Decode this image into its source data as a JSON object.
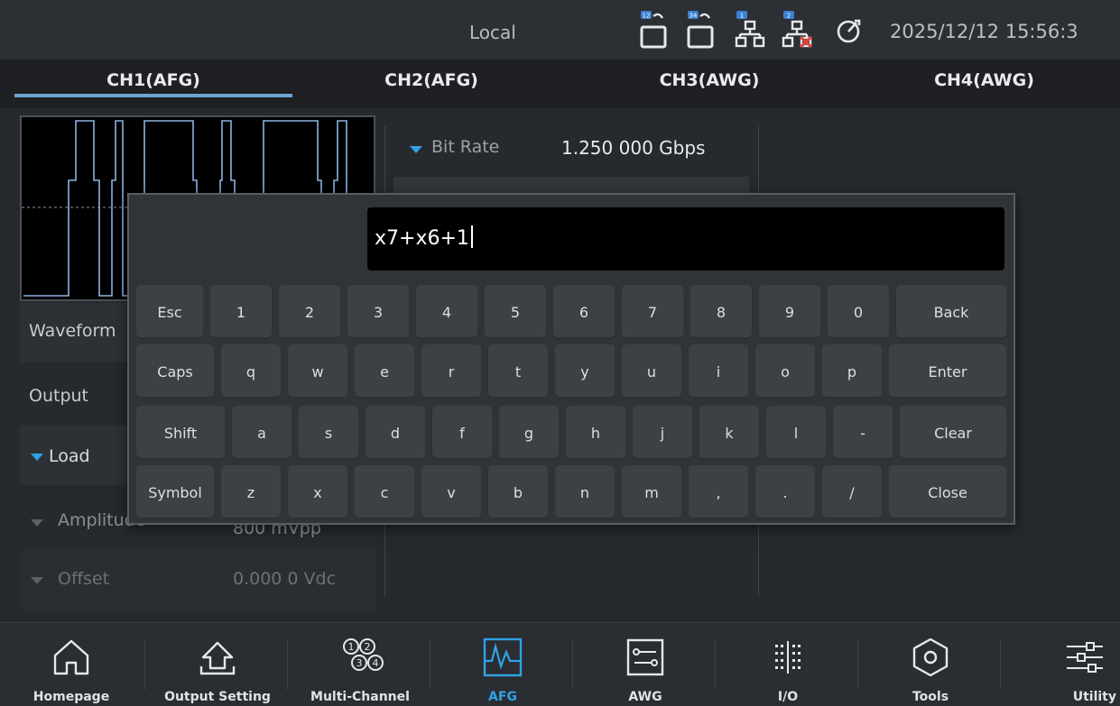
{
  "status_bar": {
    "title": "Local",
    "datetime": "2025/12/12 15:56:3",
    "icons": [
      "lock-12-icon",
      "lock-34-icon",
      "network-1-icon",
      "network-2-disconnected-icon",
      "timer-icon"
    ],
    "icon_badges": [
      "12",
      "34",
      "1",
      "2"
    ]
  },
  "tabs": [
    {
      "label": "CH1(AFG)",
      "active": true
    },
    {
      "label": "CH2(AFG)",
      "active": false
    },
    {
      "label": "CH3(AWG)",
      "active": false
    },
    {
      "label": "CH4(AWG)",
      "active": false
    }
  ],
  "left_panel": {
    "waveform_label": "Waveform",
    "output_label": "Output",
    "load_label": "Load",
    "amplitude_label": "Amplitude",
    "amplitude_value": "800 mVpp",
    "offset_label": "Offset",
    "offset_value": "0.000 0 Vdc"
  },
  "right_panel": {
    "bit_rate_label": "Bit Rate",
    "bit_rate_value": "1.250 000 Gbps"
  },
  "keyboard": {
    "input_value": "x7+x6+1",
    "rows": [
      [
        "Esc",
        "1",
        "2",
        "3",
        "4",
        "5",
        "6",
        "7",
        "8",
        "9",
        "0",
        "Back"
      ],
      [
        "Caps",
        "q",
        "w",
        "e",
        "r",
        "t",
        "y",
        "u",
        "i",
        "o",
        "p",
        "Enter"
      ],
      [
        "Shift",
        "a",
        "s",
        "d",
        "f",
        "g",
        "h",
        "j",
        "k",
        "l",
        "-",
        "Clear"
      ],
      [
        "Symbol",
        "z",
        "x",
        "c",
        "v",
        "b",
        "n",
        "m",
        ",",
        ".",
        "/",
        "Close"
      ]
    ]
  },
  "bottom_nav": [
    {
      "label": "Homepage",
      "icon": "home-icon",
      "active": false
    },
    {
      "label": "Output Setting",
      "icon": "output-setting-icon",
      "active": false
    },
    {
      "label": "Multi-Channel",
      "icon": "multi-channel-icon",
      "active": false
    },
    {
      "label": "AFG",
      "icon": "afg-waveform-icon",
      "active": true
    },
    {
      "label": "AWG",
      "icon": "awg-icon",
      "active": false
    },
    {
      "label": "I/O",
      "icon": "io-icon",
      "active": false
    },
    {
      "label": "Tools",
      "icon": "tools-hexagon-icon",
      "active": false
    },
    {
      "label": "Utility",
      "icon": "utility-sliders-icon",
      "active": false
    }
  ],
  "colors": {
    "accent": "#2fa3e6",
    "active_tab_underline": "#6ea3d3",
    "background": "#26292d",
    "alert": "#e0453a"
  }
}
